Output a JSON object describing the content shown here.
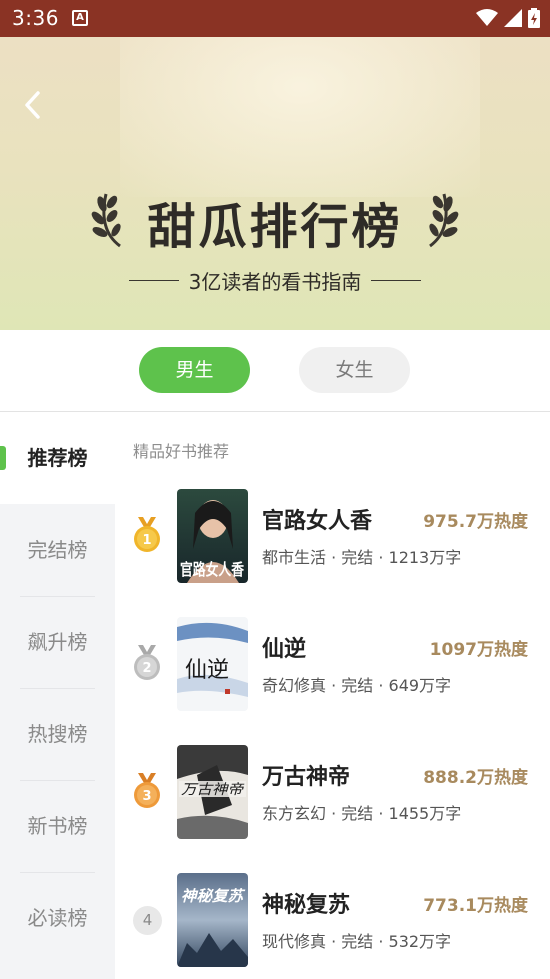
{
  "status_bar": {
    "time": "3:36",
    "notif_glyph": "A"
  },
  "hero": {
    "title": "甜瓜排行榜",
    "subtitle": "3亿读者的看书指南"
  },
  "gender_tabs": [
    {
      "label": "男生",
      "selected": true
    },
    {
      "label": "女生",
      "selected": false
    }
  ],
  "sidebar": {
    "items": [
      {
        "label": "推荐榜",
        "active": true
      },
      {
        "label": "完结榜",
        "active": false
      },
      {
        "label": "飙升榜",
        "active": false
      },
      {
        "label": "热搜榜",
        "active": false
      },
      {
        "label": "新书榜",
        "active": false
      },
      {
        "label": "必读榜",
        "active": false
      }
    ]
  },
  "list": {
    "section_label": "精品好书推荐",
    "books": [
      {
        "rank": "1",
        "title": "官路女人香",
        "heat": "975.7万热度",
        "meta": "都市生活 · 完结 · 1213万字",
        "cover_text": "官路女人香"
      },
      {
        "rank": "2",
        "title": "仙逆",
        "heat": "1097万热度",
        "meta": "奇幻修真 · 完结 · 649万字",
        "cover_text": "仙逆"
      },
      {
        "rank": "3",
        "title": "万古神帝",
        "heat": "888.2万热度",
        "meta": "东方玄幻 · 完结 · 1455万字",
        "cover_text": "万古神帝"
      },
      {
        "rank": "4",
        "title": "神秘复苏",
        "heat": "773.1万热度",
        "meta": "现代修真 · 完结 · 532万字",
        "cover_text": "神秘复苏"
      }
    ]
  },
  "colors": {
    "accent": "#5ec24c",
    "status_bar": "#8a3324",
    "heat": "#a88a5e",
    "medal_gold": "#f0b52a",
    "medal_silver": "#c8c8c8",
    "medal_bronze": "#ee9a3a"
  }
}
